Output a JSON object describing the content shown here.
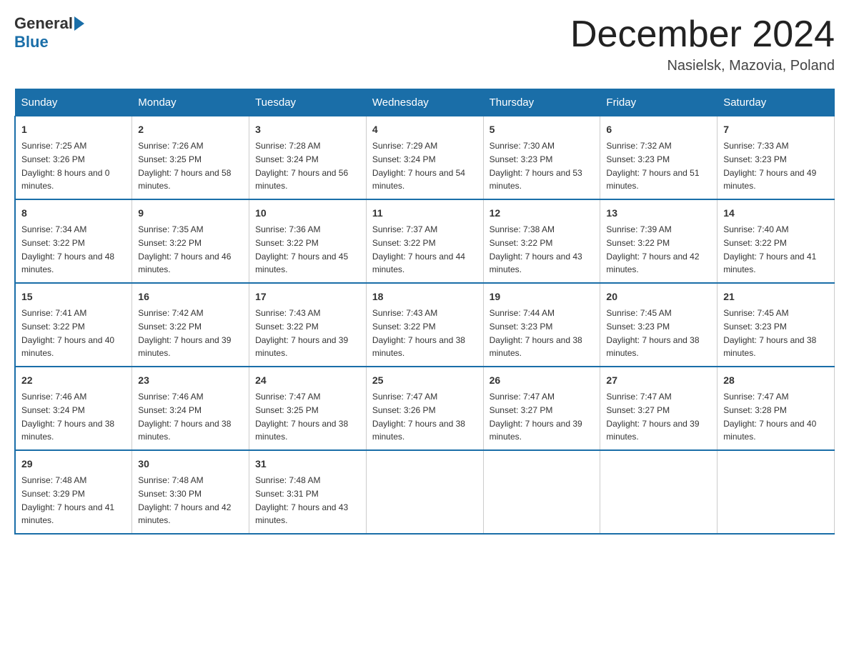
{
  "header": {
    "logo_general": "General",
    "logo_blue": "Blue",
    "month_title": "December 2024",
    "location": "Nasielsk, Mazovia, Poland"
  },
  "days_of_week": [
    "Sunday",
    "Monday",
    "Tuesday",
    "Wednesday",
    "Thursday",
    "Friday",
    "Saturday"
  ],
  "weeks": [
    [
      {
        "day": "1",
        "sunrise": "7:25 AM",
        "sunset": "3:26 PM",
        "daylight": "8 hours and 0 minutes."
      },
      {
        "day": "2",
        "sunrise": "7:26 AM",
        "sunset": "3:25 PM",
        "daylight": "7 hours and 58 minutes."
      },
      {
        "day": "3",
        "sunrise": "7:28 AM",
        "sunset": "3:24 PM",
        "daylight": "7 hours and 56 minutes."
      },
      {
        "day": "4",
        "sunrise": "7:29 AM",
        "sunset": "3:24 PM",
        "daylight": "7 hours and 54 minutes."
      },
      {
        "day": "5",
        "sunrise": "7:30 AM",
        "sunset": "3:23 PM",
        "daylight": "7 hours and 53 minutes."
      },
      {
        "day": "6",
        "sunrise": "7:32 AM",
        "sunset": "3:23 PM",
        "daylight": "7 hours and 51 minutes."
      },
      {
        "day": "7",
        "sunrise": "7:33 AM",
        "sunset": "3:23 PM",
        "daylight": "7 hours and 49 minutes."
      }
    ],
    [
      {
        "day": "8",
        "sunrise": "7:34 AM",
        "sunset": "3:22 PM",
        "daylight": "7 hours and 48 minutes."
      },
      {
        "day": "9",
        "sunrise": "7:35 AM",
        "sunset": "3:22 PM",
        "daylight": "7 hours and 46 minutes."
      },
      {
        "day": "10",
        "sunrise": "7:36 AM",
        "sunset": "3:22 PM",
        "daylight": "7 hours and 45 minutes."
      },
      {
        "day": "11",
        "sunrise": "7:37 AM",
        "sunset": "3:22 PM",
        "daylight": "7 hours and 44 minutes."
      },
      {
        "day": "12",
        "sunrise": "7:38 AM",
        "sunset": "3:22 PM",
        "daylight": "7 hours and 43 minutes."
      },
      {
        "day": "13",
        "sunrise": "7:39 AM",
        "sunset": "3:22 PM",
        "daylight": "7 hours and 42 minutes."
      },
      {
        "day": "14",
        "sunrise": "7:40 AM",
        "sunset": "3:22 PM",
        "daylight": "7 hours and 41 minutes."
      }
    ],
    [
      {
        "day": "15",
        "sunrise": "7:41 AM",
        "sunset": "3:22 PM",
        "daylight": "7 hours and 40 minutes."
      },
      {
        "day": "16",
        "sunrise": "7:42 AM",
        "sunset": "3:22 PM",
        "daylight": "7 hours and 39 minutes."
      },
      {
        "day": "17",
        "sunrise": "7:43 AM",
        "sunset": "3:22 PM",
        "daylight": "7 hours and 39 minutes."
      },
      {
        "day": "18",
        "sunrise": "7:43 AM",
        "sunset": "3:22 PM",
        "daylight": "7 hours and 38 minutes."
      },
      {
        "day": "19",
        "sunrise": "7:44 AM",
        "sunset": "3:23 PM",
        "daylight": "7 hours and 38 minutes."
      },
      {
        "day": "20",
        "sunrise": "7:45 AM",
        "sunset": "3:23 PM",
        "daylight": "7 hours and 38 minutes."
      },
      {
        "day": "21",
        "sunrise": "7:45 AM",
        "sunset": "3:23 PM",
        "daylight": "7 hours and 38 minutes."
      }
    ],
    [
      {
        "day": "22",
        "sunrise": "7:46 AM",
        "sunset": "3:24 PM",
        "daylight": "7 hours and 38 minutes."
      },
      {
        "day": "23",
        "sunrise": "7:46 AM",
        "sunset": "3:24 PM",
        "daylight": "7 hours and 38 minutes."
      },
      {
        "day": "24",
        "sunrise": "7:47 AM",
        "sunset": "3:25 PM",
        "daylight": "7 hours and 38 minutes."
      },
      {
        "day": "25",
        "sunrise": "7:47 AM",
        "sunset": "3:26 PM",
        "daylight": "7 hours and 38 minutes."
      },
      {
        "day": "26",
        "sunrise": "7:47 AM",
        "sunset": "3:27 PM",
        "daylight": "7 hours and 39 minutes."
      },
      {
        "day": "27",
        "sunrise": "7:47 AM",
        "sunset": "3:27 PM",
        "daylight": "7 hours and 39 minutes."
      },
      {
        "day": "28",
        "sunrise": "7:47 AM",
        "sunset": "3:28 PM",
        "daylight": "7 hours and 40 minutes."
      }
    ],
    [
      {
        "day": "29",
        "sunrise": "7:48 AM",
        "sunset": "3:29 PM",
        "daylight": "7 hours and 41 minutes."
      },
      {
        "day": "30",
        "sunrise": "7:48 AM",
        "sunset": "3:30 PM",
        "daylight": "7 hours and 42 minutes."
      },
      {
        "day": "31",
        "sunrise": "7:48 AM",
        "sunset": "3:31 PM",
        "daylight": "7 hours and 43 minutes."
      },
      null,
      null,
      null,
      null
    ]
  ]
}
